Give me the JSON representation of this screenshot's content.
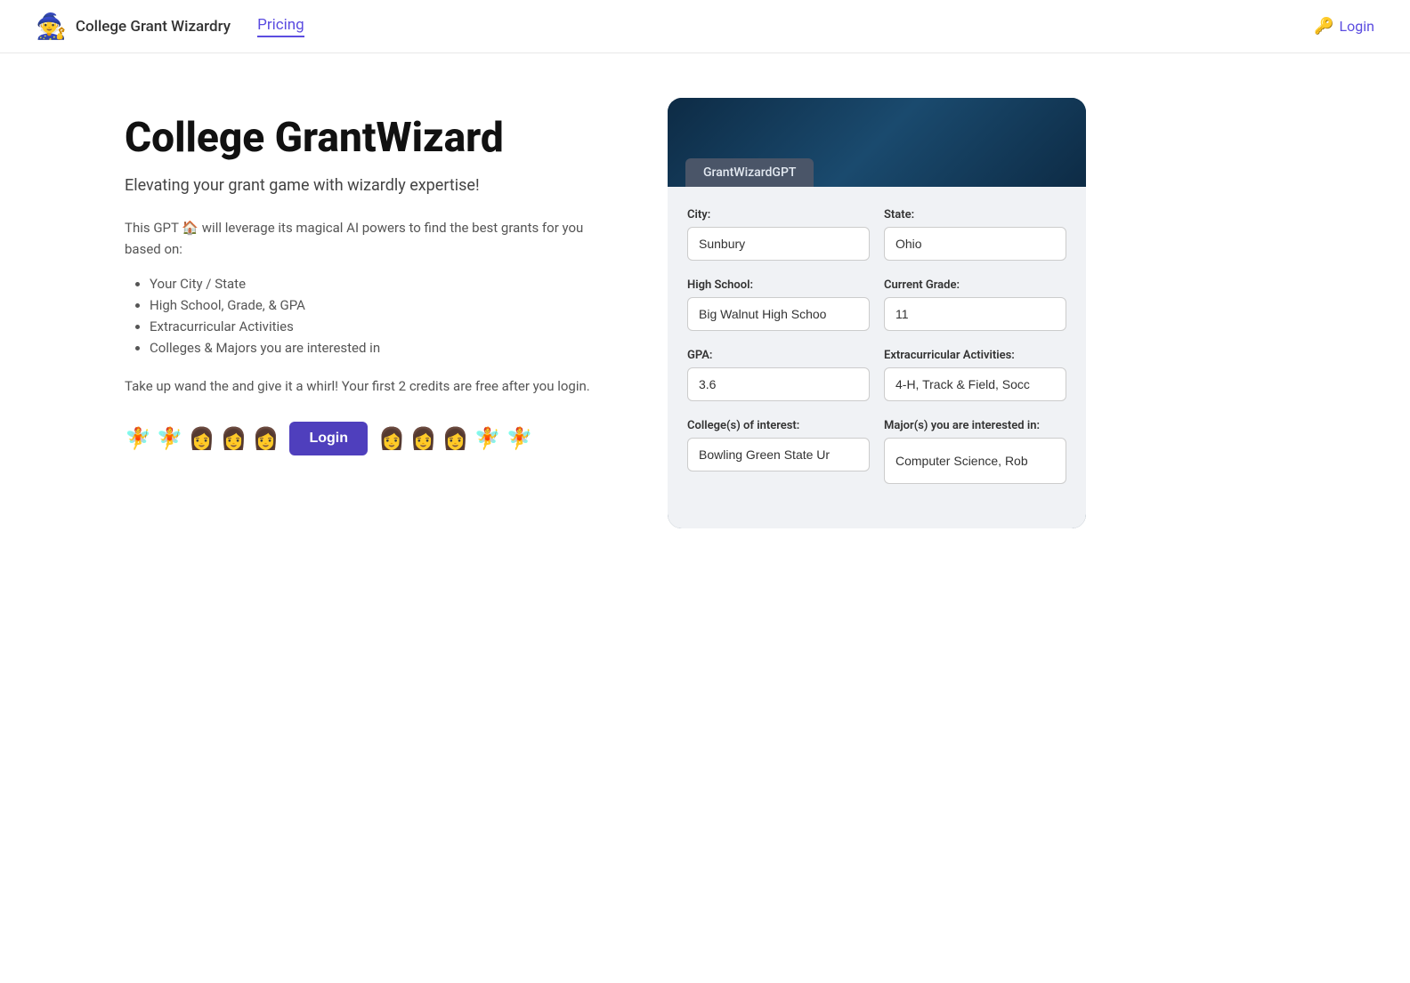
{
  "nav": {
    "logo_icon": "🧙",
    "logo_text": "College Grant Wizardry",
    "pricing_label": "Pricing",
    "login_label": "Login",
    "login_icon": "🔑"
  },
  "hero": {
    "title": "College GrantWizard",
    "subtitle": "Elevating your grant game with wizardly expertise!",
    "intro": "This GPT 🏠 will leverage its magical AI powers to find the best grants for you based on:",
    "features": [
      "Your City / State",
      "High School, Grade, & GPA",
      "Extracurricular Activities",
      "Colleges & Majors you are interested in"
    ],
    "cta": "Take up wand the and give it a whirl! Your first 2 credits are free after you login."
  },
  "emojis_left": [
    "🧚",
    "🧚",
    "👩",
    "👩",
    "👩"
  ],
  "login_button_label": "Login",
  "emojis_right": [
    "👩",
    "👩",
    "👩",
    "🧚",
    "🧚"
  ],
  "gpt_widget": {
    "tab_label": "GrantWizardGPT",
    "fields": {
      "city_label": "City:",
      "city_value": "Sunbury",
      "state_label": "State:",
      "state_value": "Ohio",
      "high_school_label": "High School:",
      "high_school_value": "Big Walnut High Schoo",
      "current_grade_label": "Current Grade:",
      "current_grade_value": "11",
      "gpa_label": "GPA:",
      "gpa_value": "3.6",
      "extracurricular_label": "Extracurricular Activities:",
      "extracurricular_value": "4-H, Track & Field, Socc",
      "colleges_label": "College(s) of interest:",
      "colleges_value": "Bowling Green State Ur",
      "majors_label": "Major(s) you are interested in:",
      "majors_value": "Computer Science, Rob"
    }
  }
}
